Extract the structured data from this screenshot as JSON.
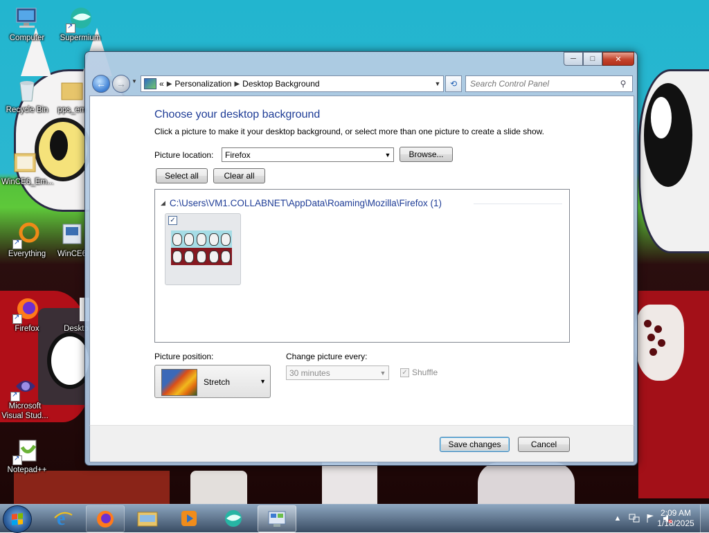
{
  "desktop": {
    "icons": [
      {
        "label": "Computer"
      },
      {
        "label": "Supermium"
      },
      {
        "label": "Recycle Bin"
      },
      {
        "label": "pps_em"
      },
      {
        "label": "WinCE6_Em..."
      },
      {
        "label": "Everything"
      },
      {
        "label": "WinCE6"
      },
      {
        "label": "Firefox"
      },
      {
        "label": "Deskto"
      },
      {
        "label": "Microsoft Visual Stud..."
      },
      {
        "label": "Notepad++"
      }
    ]
  },
  "window": {
    "controls": {
      "minimize": "─",
      "maximize": "□",
      "close": "✕"
    },
    "breadcrumb": {
      "prefix": "«",
      "items": [
        "Personalization",
        "Desktop Background"
      ]
    },
    "search_placeholder": "Search Control Panel",
    "title": "Choose your desktop background",
    "subtitle": "Click a picture to make it your desktop background, or select more than one picture to create a slide show.",
    "picture_location": {
      "label": "Picture location:",
      "value": "Firefox",
      "browse_label": "Browse..."
    },
    "select_all_label": "Select all",
    "clear_all_label": "Clear all",
    "group": {
      "header": "C:\\Users\\VM1.COLLABNET\\AppData\\Roaming\\Mozilla\\Firefox (1)",
      "thumbnail_checked": "✓"
    },
    "picture_position": {
      "label": "Picture position:",
      "value": "Stretch"
    },
    "change_picture": {
      "label": "Change picture every:",
      "value": "30 minutes"
    },
    "shuffle": {
      "label": "Shuffle",
      "checked": "✓"
    },
    "save_label": "Save changes",
    "cancel_label": "Cancel"
  },
  "taskbar": {
    "clock": {
      "time": "2:09 AM",
      "date": "1/18/2025"
    },
    "tray_expand": "▲"
  },
  "colors": {
    "title_blue": "#1e3c96",
    "accent": "#3c7fb1"
  }
}
